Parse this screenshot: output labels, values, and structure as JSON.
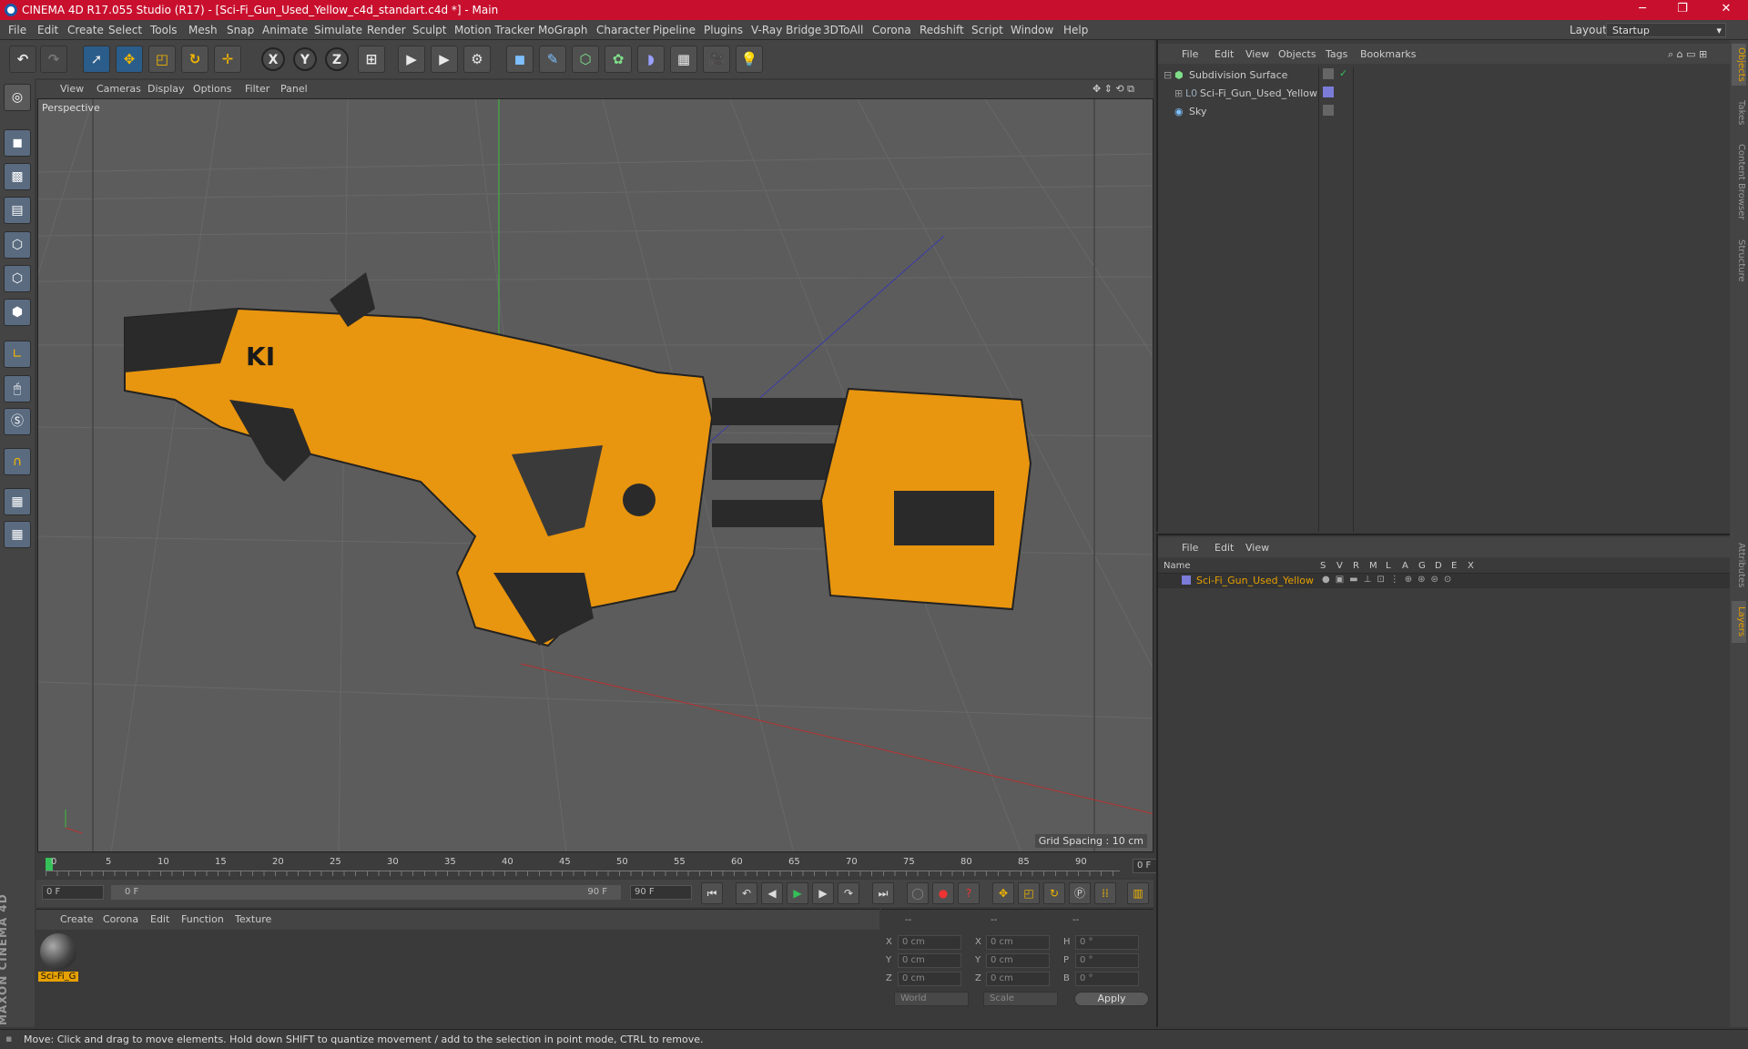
{
  "window": {
    "title": "CINEMA 4D R17.055 Studio (R17) - [Sci-Fi_Gun_Used_Yellow_c4d_standart.c4d *] - Main",
    "min": "─",
    "max": "❐",
    "close": "✕"
  },
  "menu": [
    "File",
    "Edit",
    "Create",
    "Select",
    "Tools",
    "Mesh",
    "Snap",
    "Animate",
    "Simulate",
    "Render",
    "Sculpt",
    "Motion Tracker",
    "MoGraph",
    "Character",
    "Pipeline",
    "Plugins",
    "V-Ray Bridge",
    "3DToAll",
    "Corona",
    "Redshift",
    "Script",
    "Window",
    "Help"
  ],
  "layout": {
    "label": "Layout:",
    "value": "Startup"
  },
  "toolbar": {
    "x": "X",
    "y": "Y",
    "z": "Z"
  },
  "viewport": {
    "menu": [
      "View",
      "Cameras",
      "Display",
      "Options",
      "Filter",
      "Panel"
    ],
    "label": "Perspective",
    "grid_spacing": "Grid Spacing : 10 cm"
  },
  "timeline": {
    "ticks": [
      "0",
      "5",
      "10",
      "15",
      "20",
      "25",
      "30",
      "35",
      "40",
      "45",
      "50",
      "55",
      "60",
      "65",
      "70",
      "75",
      "80",
      "85",
      "90"
    ],
    "current": "0 F"
  },
  "transport": {
    "start": "0 F",
    "range_start": "0 F",
    "range_end": "90 F",
    "end": "90 F"
  },
  "material": {
    "menu": [
      "Create",
      "Corona",
      "Edit",
      "Function",
      "Texture"
    ],
    "name": "Sci-Fi_G"
  },
  "coords": {
    "dash": "--",
    "rows": [
      {
        "a": "X",
        "v1": "0 cm",
        "b": "X",
        "v2": "0 cm",
        "c": "H",
        "v3": "0 °"
      },
      {
        "a": "Y",
        "v1": "0 cm",
        "b": "Y",
        "v2": "0 cm",
        "c": "P",
        "v3": "0 °"
      },
      {
        "a": "Z",
        "v1": "0 cm",
        "b": "Z",
        "v2": "0 cm",
        "c": "B",
        "v3": "0 °"
      }
    ],
    "world": "World",
    "scale": "Scale",
    "apply": "Apply"
  },
  "objects": {
    "menu": [
      "File",
      "Edit",
      "View",
      "Objects",
      "Tags",
      "Bookmarks"
    ],
    "items": [
      "Subdivision Surface",
      "Sci-Fi_Gun_Used_Yellow",
      "Sky"
    ]
  },
  "layers": {
    "menu": [
      "File",
      "Edit",
      "View"
    ],
    "cols": [
      "Name",
      "S",
      "V",
      "R",
      "M",
      "L",
      "A",
      "G",
      "D",
      "E",
      "X"
    ],
    "row": "Sci-Fi_Gun_Used_Yellow"
  },
  "side_tabs": [
    "Objects",
    "Takes",
    "Content Browser",
    "Structure",
    "Attributes",
    "Layers"
  ],
  "brand": "MAXON CINEMA 4D",
  "status": "Move: Click and drag to move elements. Hold down SHIFT to quantize movement / add to the selection in point mode, CTRL to remove.",
  "colors": {
    "accent": "#e6a000",
    "title_red": "#c8102e",
    "layer_purple": "#7b7bd8"
  }
}
